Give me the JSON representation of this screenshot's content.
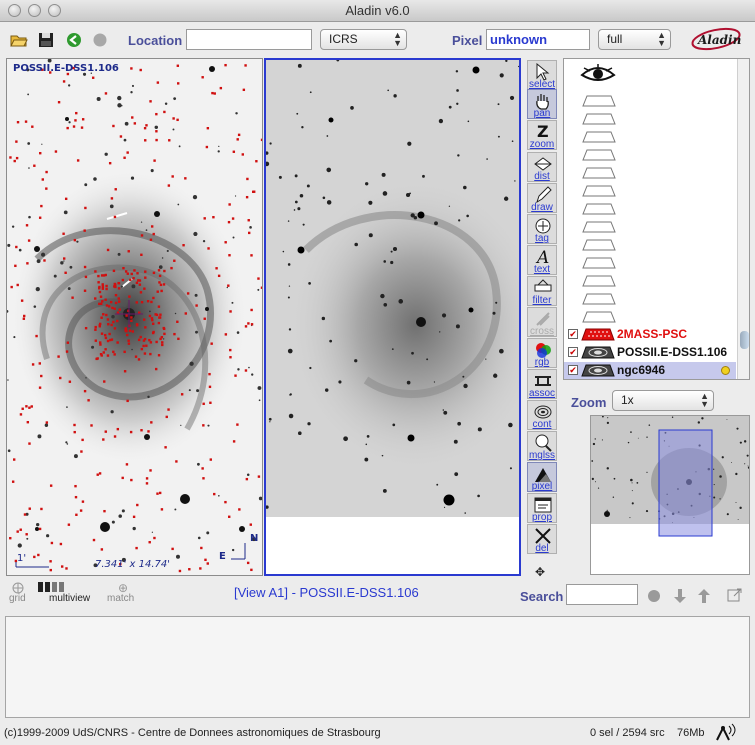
{
  "window": {
    "title": "Aladin v6.0"
  },
  "toolbar": {
    "location_label": "Location",
    "location_value": "",
    "frame_select": "ICRS",
    "pixel_label": "Pixel",
    "pixel_value": "unknown",
    "pixel_mode_select": "full"
  },
  "view_a": {
    "survey_label": "POSSII.E-DSS1.106",
    "scale_label": "1'",
    "size_label": "7.341' x 14.74'",
    "north_label": "N",
    "east_label": "E"
  },
  "tools": [
    {
      "name": "select",
      "label": "select"
    },
    {
      "name": "pan",
      "label": "pan"
    },
    {
      "name": "zoom",
      "label": "zoom"
    },
    {
      "name": "dist",
      "label": "dist"
    },
    {
      "name": "draw",
      "label": "draw"
    },
    {
      "name": "tag",
      "label": "tag"
    },
    {
      "name": "text",
      "label": "text"
    },
    {
      "name": "filter",
      "label": "filter"
    },
    {
      "name": "cross",
      "label": "cross"
    },
    {
      "name": "rgb",
      "label": "rgb"
    },
    {
      "name": "assoc",
      "label": "assoc"
    },
    {
      "name": "cont",
      "label": "cont"
    },
    {
      "name": "mglss",
      "label": "mglss"
    },
    {
      "name": "pixel",
      "label": "pixel"
    },
    {
      "name": "prop",
      "label": "prop"
    },
    {
      "name": "del",
      "label": "del"
    }
  ],
  "layers": [
    {
      "name": "2MASS-PSC",
      "color": "#e01010",
      "checked": true
    },
    {
      "name": "POSSII.E-DSS1.106",
      "color": "#111111",
      "checked": true
    },
    {
      "name": "ngc6946",
      "color": "#111111",
      "checked": true
    }
  ],
  "zoom": {
    "label": "Zoom",
    "value": "1x"
  },
  "bottom_bar": {
    "grid_label": "grid",
    "multiview_label": "multiview",
    "match_label": "match",
    "view_title": "[View A1] - POSSII.E-DSS1.106",
    "search_label": "Search",
    "search_value": ""
  },
  "footer": {
    "copyright": "(c)1999-2009 UdS/CNRS - Centre de Donnees astronomiques de Strasbourg",
    "selection": "0 sel / 2594 src",
    "memory": "76Mb"
  },
  "colors": {
    "accent": "#2a3ad0",
    "label": "#4a4f9a",
    "source_marker": "#d01010"
  }
}
